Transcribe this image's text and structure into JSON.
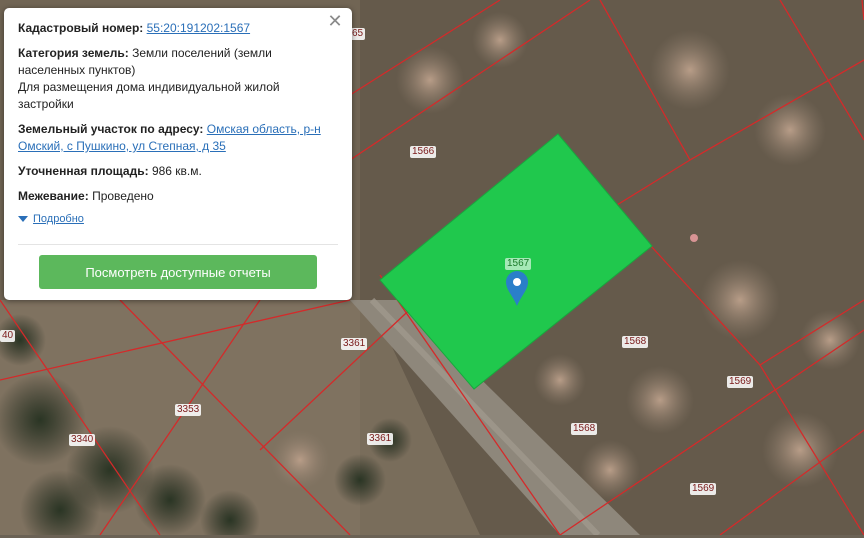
{
  "popup": {
    "cadastral_label": "Кадастровый номер:",
    "cadastral_value": "55:20:191202:1567",
    "category_label": "Категория земель:",
    "category_value": "Земли поселений (земли населенных пунктов)",
    "usage_value": "Для размещения дома индивидуальной жилой застройки",
    "address_label": "Земельный участок по адресу:",
    "address_value": "Омская область, р-н Омский, с Пушкино, ул Степная, д 35",
    "area_label": "Уточненная площадь:",
    "area_value": "986 кв.м.",
    "survey_label": "Межевание:",
    "survey_value": "Проведено",
    "more_label": "Подробно",
    "reports_button": "Посмотреть доступные отчеты",
    "close_icon": "close-icon"
  },
  "map": {
    "selected_parcel_color": "#20c84d",
    "boundary_color": "#d42a2a",
    "marker_color": "#2a7fc9",
    "parcel_labels": {
      "p1565": "65",
      "p1566": "1566",
      "p1567": "1567",
      "p1568a": "1568",
      "p1568b": "1568",
      "p1569a": "1569",
      "p1569b": "1569",
      "p3361a": "3361",
      "p3361b": "3361",
      "p3353": "3353",
      "p3340": "3340",
      "p40": "40"
    }
  }
}
